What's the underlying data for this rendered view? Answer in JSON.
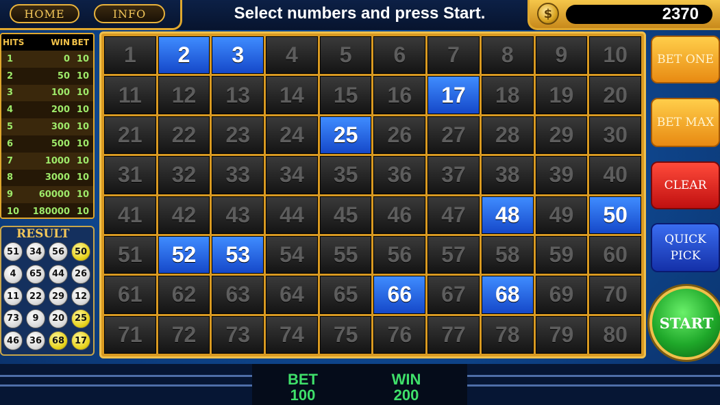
{
  "top": {
    "home_label": "HOME",
    "info_label": "INFO",
    "instruction": "Select numbers and press Start.",
    "coin_symbol": "$",
    "credits": "2370"
  },
  "paytable": {
    "headers": {
      "hits": "HITS",
      "win": "WIN",
      "bet": "BET"
    },
    "rows": [
      {
        "hits": "1",
        "win": "0",
        "bet": "10"
      },
      {
        "hits": "2",
        "win": "50",
        "bet": "10"
      },
      {
        "hits": "3",
        "win": "100",
        "bet": "10"
      },
      {
        "hits": "4",
        "win": "200",
        "bet": "10"
      },
      {
        "hits": "5",
        "win": "300",
        "bet": "10"
      },
      {
        "hits": "6",
        "win": "500",
        "bet": "10"
      },
      {
        "hits": "7",
        "win": "1000",
        "bet": "10"
      },
      {
        "hits": "8",
        "win": "3000",
        "bet": "10"
      },
      {
        "hits": "9",
        "win": "60000",
        "bet": "10"
      },
      {
        "hits": "10",
        "win": "180000",
        "bet": "10"
      }
    ]
  },
  "result": {
    "title": "RESULT",
    "balls": [
      {
        "n": "51",
        "hit": false
      },
      {
        "n": "34",
        "hit": false
      },
      {
        "n": "56",
        "hit": false
      },
      {
        "n": "50",
        "hit": true
      },
      {
        "n": "4",
        "hit": false
      },
      {
        "n": "65",
        "hit": false
      },
      {
        "n": "44",
        "hit": false
      },
      {
        "n": "26",
        "hit": false
      },
      {
        "n": "11",
        "hit": false
      },
      {
        "n": "22",
        "hit": false
      },
      {
        "n": "29",
        "hit": false
      },
      {
        "n": "12",
        "hit": false
      },
      {
        "n": "73",
        "hit": false
      },
      {
        "n": "9",
        "hit": false
      },
      {
        "n": "20",
        "hit": false
      },
      {
        "n": "25",
        "hit": true
      },
      {
        "n": "46",
        "hit": false
      },
      {
        "n": "36",
        "hit": false
      },
      {
        "n": "68",
        "hit": true
      },
      {
        "n": "17",
        "hit": true
      }
    ]
  },
  "board": {
    "numbers": [
      "1",
      "2",
      "3",
      "4",
      "5",
      "6",
      "7",
      "8",
      "9",
      "10",
      "11",
      "12",
      "13",
      "14",
      "15",
      "16",
      "17",
      "18",
      "19",
      "20",
      "21",
      "22",
      "23",
      "24",
      "25",
      "26",
      "27",
      "28",
      "29",
      "30",
      "31",
      "32",
      "33",
      "34",
      "35",
      "36",
      "37",
      "38",
      "39",
      "40",
      "41",
      "42",
      "43",
      "44",
      "45",
      "46",
      "47",
      "48",
      "49",
      "50",
      "51",
      "52",
      "53",
      "54",
      "55",
      "56",
      "57",
      "58",
      "59",
      "60",
      "61",
      "62",
      "63",
      "64",
      "65",
      "66",
      "67",
      "68",
      "69",
      "70",
      "71",
      "72",
      "73",
      "74",
      "75",
      "76",
      "77",
      "78",
      "79",
      "80"
    ],
    "selected": [
      "2",
      "3",
      "17",
      "25",
      "48",
      "50",
      "52",
      "53",
      "66",
      "68"
    ]
  },
  "buttons": {
    "bet_one": "BET ONE",
    "bet_max": "BET MAX",
    "clear": "CLEAR",
    "quick_pick": "QUICK PICK",
    "start": "START"
  },
  "status": {
    "bet_label": "BET",
    "bet_value": "100",
    "win_label": "WIN",
    "win_value": "200"
  },
  "colors": {
    "selected_cell": "#1e5bdc",
    "hit_ball": "#e6d21a",
    "gold_frame": "#e0a82e",
    "status_text": "#3fe06a"
  }
}
